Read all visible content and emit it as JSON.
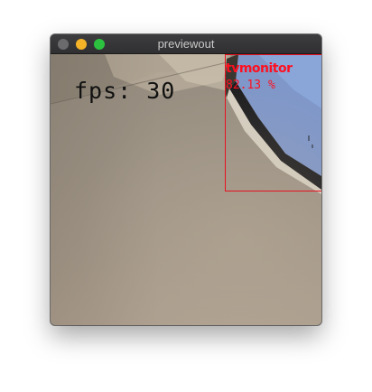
{
  "window": {
    "title": "previewout"
  },
  "overlay": {
    "fps_text": "fps: 30"
  },
  "detection": {
    "label": "tvmonitor",
    "confidence": "82.13 %",
    "box_color": "#e6121f"
  },
  "colors": {
    "close": "#6b6b6d",
    "minimize": "#f5b428",
    "maximize": "#2cc23f"
  }
}
